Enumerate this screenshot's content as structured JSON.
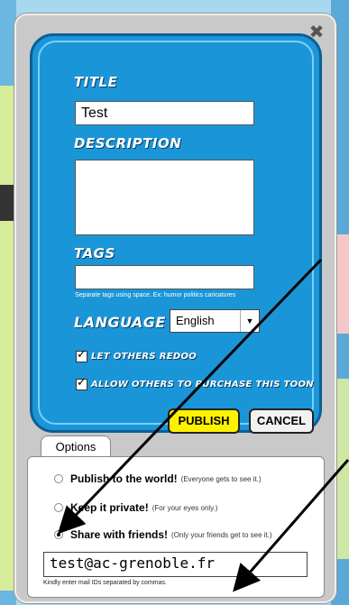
{
  "dialog": {
    "close_icon": "close-icon",
    "title_label": "TITLE",
    "title_value": "Test",
    "description_label": "DESCRIPTION",
    "description_value": "",
    "tags_label": "TAGS",
    "tags_value": "",
    "tags_hint": "Separate tags using space.     Ex: humor politics caricatures",
    "language_label": "LANGUAGE",
    "language_value": "English",
    "checkbox_redoo": "LET OTHERS REDOO",
    "checkbox_purchase": "ALLOW OTHERS TO PURCHASE THIS TOON",
    "publish_label": "PUBLISH",
    "cancel_label": "CANCEL"
  },
  "options": {
    "tab_label": "Options",
    "items": [
      {
        "title": "Publish to the world!",
        "desc": "(Everyone gets to see it.)",
        "selected": false
      },
      {
        "title": "Keep it private!",
        "desc": "(For your eyes only.)",
        "selected": false
      },
      {
        "title": "Share with friends!",
        "desc": "(Only your friends get to see it.)",
        "selected": true
      }
    ],
    "email_value": "test@ac-grenoble.fr",
    "email_hint": "Kindly enter mail IDs separated by commas."
  },
  "colors": {
    "panel_blue": "#1a96d8",
    "publish_yellow": "#fff200"
  }
}
